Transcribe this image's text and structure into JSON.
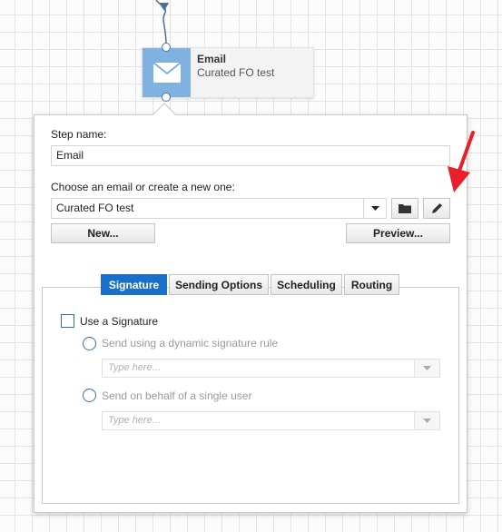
{
  "node": {
    "title": "Email",
    "subtitle": "Curated FO test"
  },
  "form": {
    "step_name_label": "Step name:",
    "step_name_value": "Email",
    "choose_label": "Choose an email or create a new one:",
    "email_value": "Curated FO test",
    "new_button": "New...",
    "preview_button": "Preview..."
  },
  "tabs": [
    {
      "label": "Signature",
      "active": true
    },
    {
      "label": "Sending Options",
      "active": false
    },
    {
      "label": "Scheduling",
      "active": false
    },
    {
      "label": "Routing",
      "active": false
    }
  ],
  "signature": {
    "use_signature_label": "Use a Signature",
    "dynamic_label": "Send using a dynamic signature rule",
    "dynamic_placeholder": "Type here...",
    "single_user_label": "Send on behalf of a single user",
    "single_user_placeholder": "Type here..."
  },
  "colors": {
    "accent": "#1a6fc9",
    "node_icon_bg": "#7fb2e0",
    "annotation_arrow": "#e8202a"
  },
  "icons": {
    "node": "envelope-icon",
    "dropdown": "caret-down-icon",
    "browse": "folder-icon",
    "edit": "pencil-icon"
  }
}
